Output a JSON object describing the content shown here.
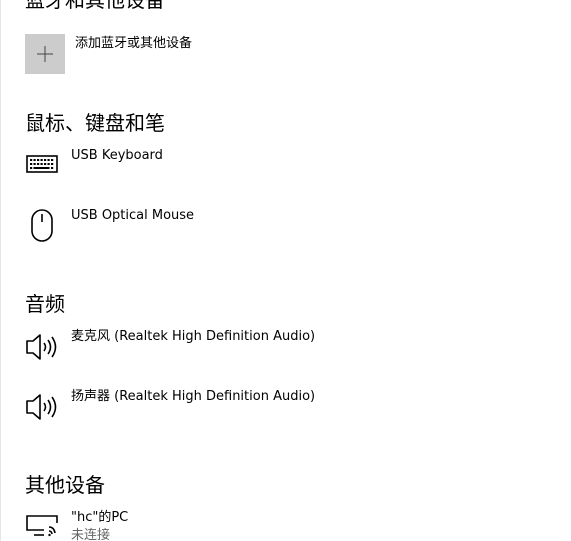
{
  "sections": {
    "bluetooth": {
      "title": "蓝牙和其他设备",
      "add_label": "添加蓝牙或其他设备"
    },
    "mouse_keyboard_pen": {
      "title": "鼠标、键盘和笔",
      "devices": [
        {
          "name": "USB Keyboard",
          "icon": "keyboard-icon"
        },
        {
          "name": "USB Optical Mouse",
          "icon": "mouse-icon"
        }
      ]
    },
    "audio": {
      "title": "音频",
      "devices": [
        {
          "name": "麦克风 (Realtek High Definition Audio)",
          "icon": "speaker-icon"
        },
        {
          "name": "扬声器 (Realtek High Definition Audio)",
          "icon": "speaker-icon"
        }
      ]
    },
    "other": {
      "title": "其他设备",
      "devices": [
        {
          "name": "\"hc\"的PC",
          "status": "未连接",
          "icon": "wireless-display-icon"
        }
      ]
    }
  },
  "colors": {
    "add_tile_background": "#cccccc",
    "icon_stroke": "#000000",
    "secondary_text": "#666666"
  }
}
